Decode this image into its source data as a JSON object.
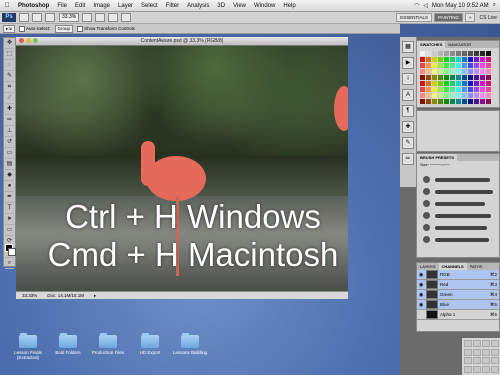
{
  "menubar": {
    "app_name": "Photoshop",
    "items": [
      "File",
      "Edit",
      "Image",
      "Layer",
      "Select",
      "Filter",
      "Analysis",
      "3D",
      "View",
      "Window",
      "Help"
    ],
    "datetime": "Mon May 10  9:52 AM"
  },
  "appbar": {
    "logo": "Ps",
    "zoom": "33.3%",
    "workspaces": [
      "ESSENTIALS",
      "PAINTING",
      "»"
    ],
    "active_workspace": "PAINTING",
    "cs_live": "CS Live"
  },
  "options_bar": {
    "auto_select_label": "Auto-Select:",
    "auto_select_value": "Group",
    "show_transform_label": "Show Transform Controls"
  },
  "document": {
    "title": "ContentAware.psd @ 33.3% (RGB/8)",
    "zoom_status": "33.33%",
    "doc_size": "Doc: 14.1M/15.1M",
    "overlay_line1": "Ctrl + H  Windows",
    "overlay_line2": "Cmd + H Macintosh"
  },
  "panels": {
    "swatches_tabs": [
      "SWATCHES",
      "NAVIGATOR"
    ],
    "brushes_tab": "BRUSH PRESETS",
    "brush_size_label": "Size:",
    "layers_tabs": [
      "LAYERS",
      "CHANNELS",
      "PATHS"
    ],
    "channels": [
      {
        "name": "RGB",
        "key": "⌘2"
      },
      {
        "name": "Red",
        "key": "⌘3"
      },
      {
        "name": "Green",
        "key": "⌘4"
      },
      {
        "name": "Blue",
        "key": "⌘5"
      },
      {
        "name": "Alpha 1",
        "key": "⌘6"
      }
    ]
  },
  "desktop_folders": [
    "Lesson Finals (Extracted)",
    "Bold Folders",
    "Production Files",
    "HD Export",
    "Lessons Building"
  ],
  "colors": {
    "menubar_bg": "#e6e6e6",
    "selected_row": "#aec6ef",
    "overlay_text": "#ffffff"
  }
}
